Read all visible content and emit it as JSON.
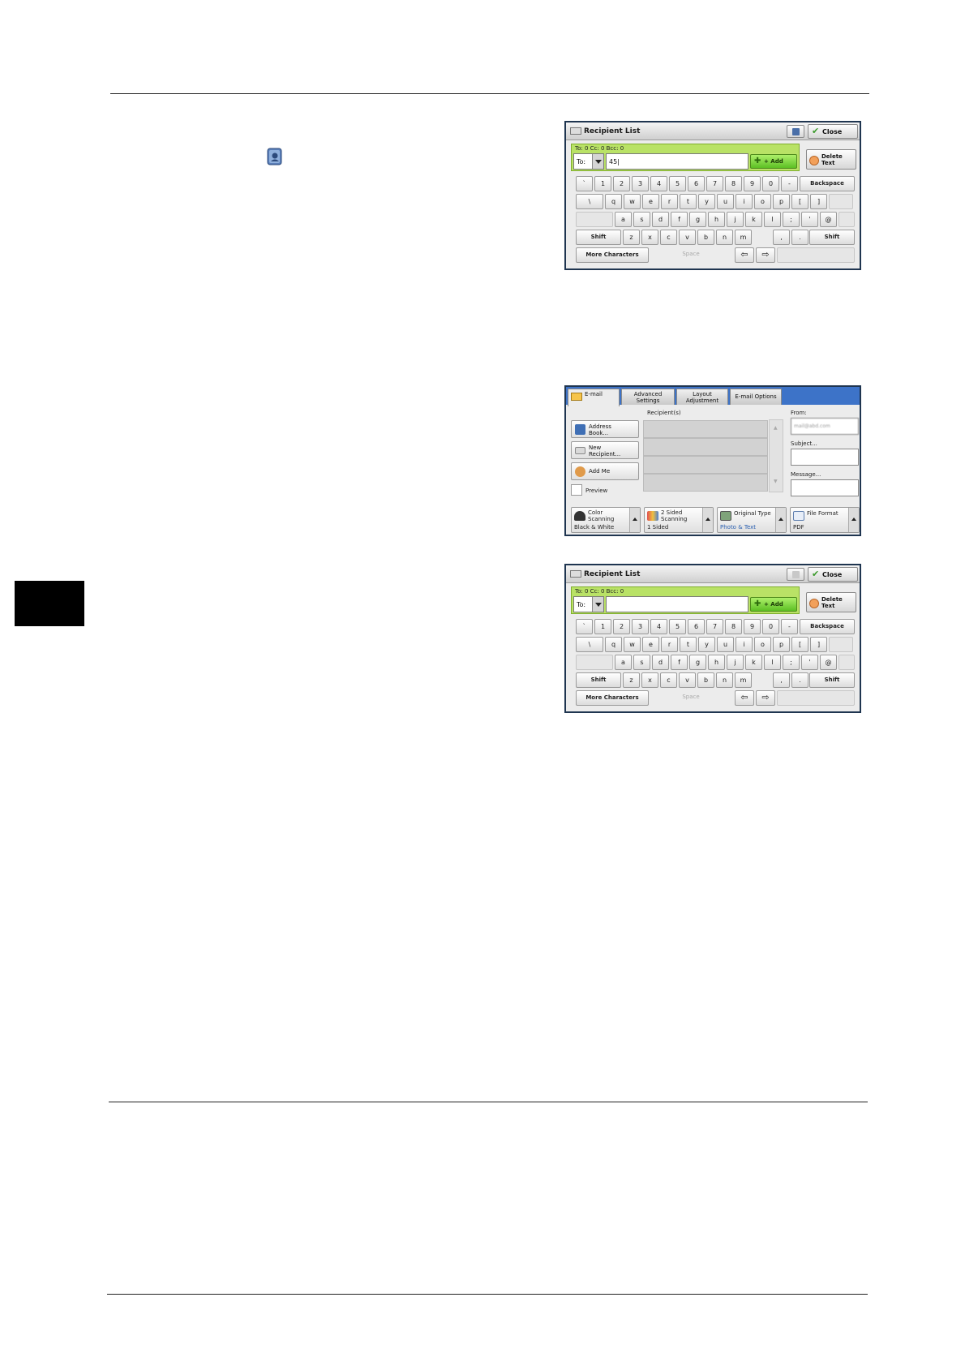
{
  "screen1": {
    "title": "Recipient List",
    "close_label": "Close",
    "counts": "To: 0  Cc: 0  Bcc: 0",
    "to_label": "To:",
    "input_value": "45|",
    "add_label": "+ Add",
    "delete_text_label": "Delete Text"
  },
  "screen3": {
    "title": "Recipient List",
    "close_label": "Close",
    "counts": "To: 0  Cc: 0  Bcc: 0",
    "to_label": "To:",
    "input_value": "",
    "add_label": "+ Add",
    "delete_text_label": "Delete Text"
  },
  "keyboard": {
    "row1": [
      "`",
      "1",
      "2",
      "3",
      "4",
      "5",
      "6",
      "7",
      "8",
      "9",
      "0",
      "-"
    ],
    "row2": [
      "\\",
      "q",
      "w",
      "e",
      "r",
      "t",
      "y",
      "u",
      "i",
      "o",
      "p",
      "[",
      "]"
    ],
    "row3": [
      "a",
      "s",
      "d",
      "f",
      "g",
      "h",
      "j",
      "k",
      "l",
      ";",
      "'",
      "@"
    ],
    "row4": [
      "z",
      "x",
      "c",
      "v",
      "b",
      "n",
      "m",
      ",",
      ".",
      "/"
    ],
    "backspace": "Backspace",
    "shift": "Shift",
    "more_characters": "More Characters",
    "space": "Space",
    "left_arrow": "⇦",
    "right_arrow": "⇨"
  },
  "email_screen": {
    "tabs": [
      "E-mail",
      "Advanced\nSettings",
      "Layout\nAdjustment",
      "E-mail Options"
    ],
    "recipients_label": "Recipient(s)",
    "address_book": "Address\nBook...",
    "new_recipient": "New\nRecipient...",
    "add_me": "Add Me",
    "preview": "Preview",
    "from_label": "From:",
    "from_value": "mail@abd.com",
    "subject_label": "Subject...",
    "message_label": "Message...",
    "features": [
      {
        "label": "Color\nScanning",
        "value": "Black & White"
      },
      {
        "label": "2 Sided\nScanning",
        "value": "1 Sided"
      },
      {
        "label": "Original Type",
        "value": "Photo & Text"
      },
      {
        "label": "File Format",
        "value": "PDF"
      }
    ]
  }
}
